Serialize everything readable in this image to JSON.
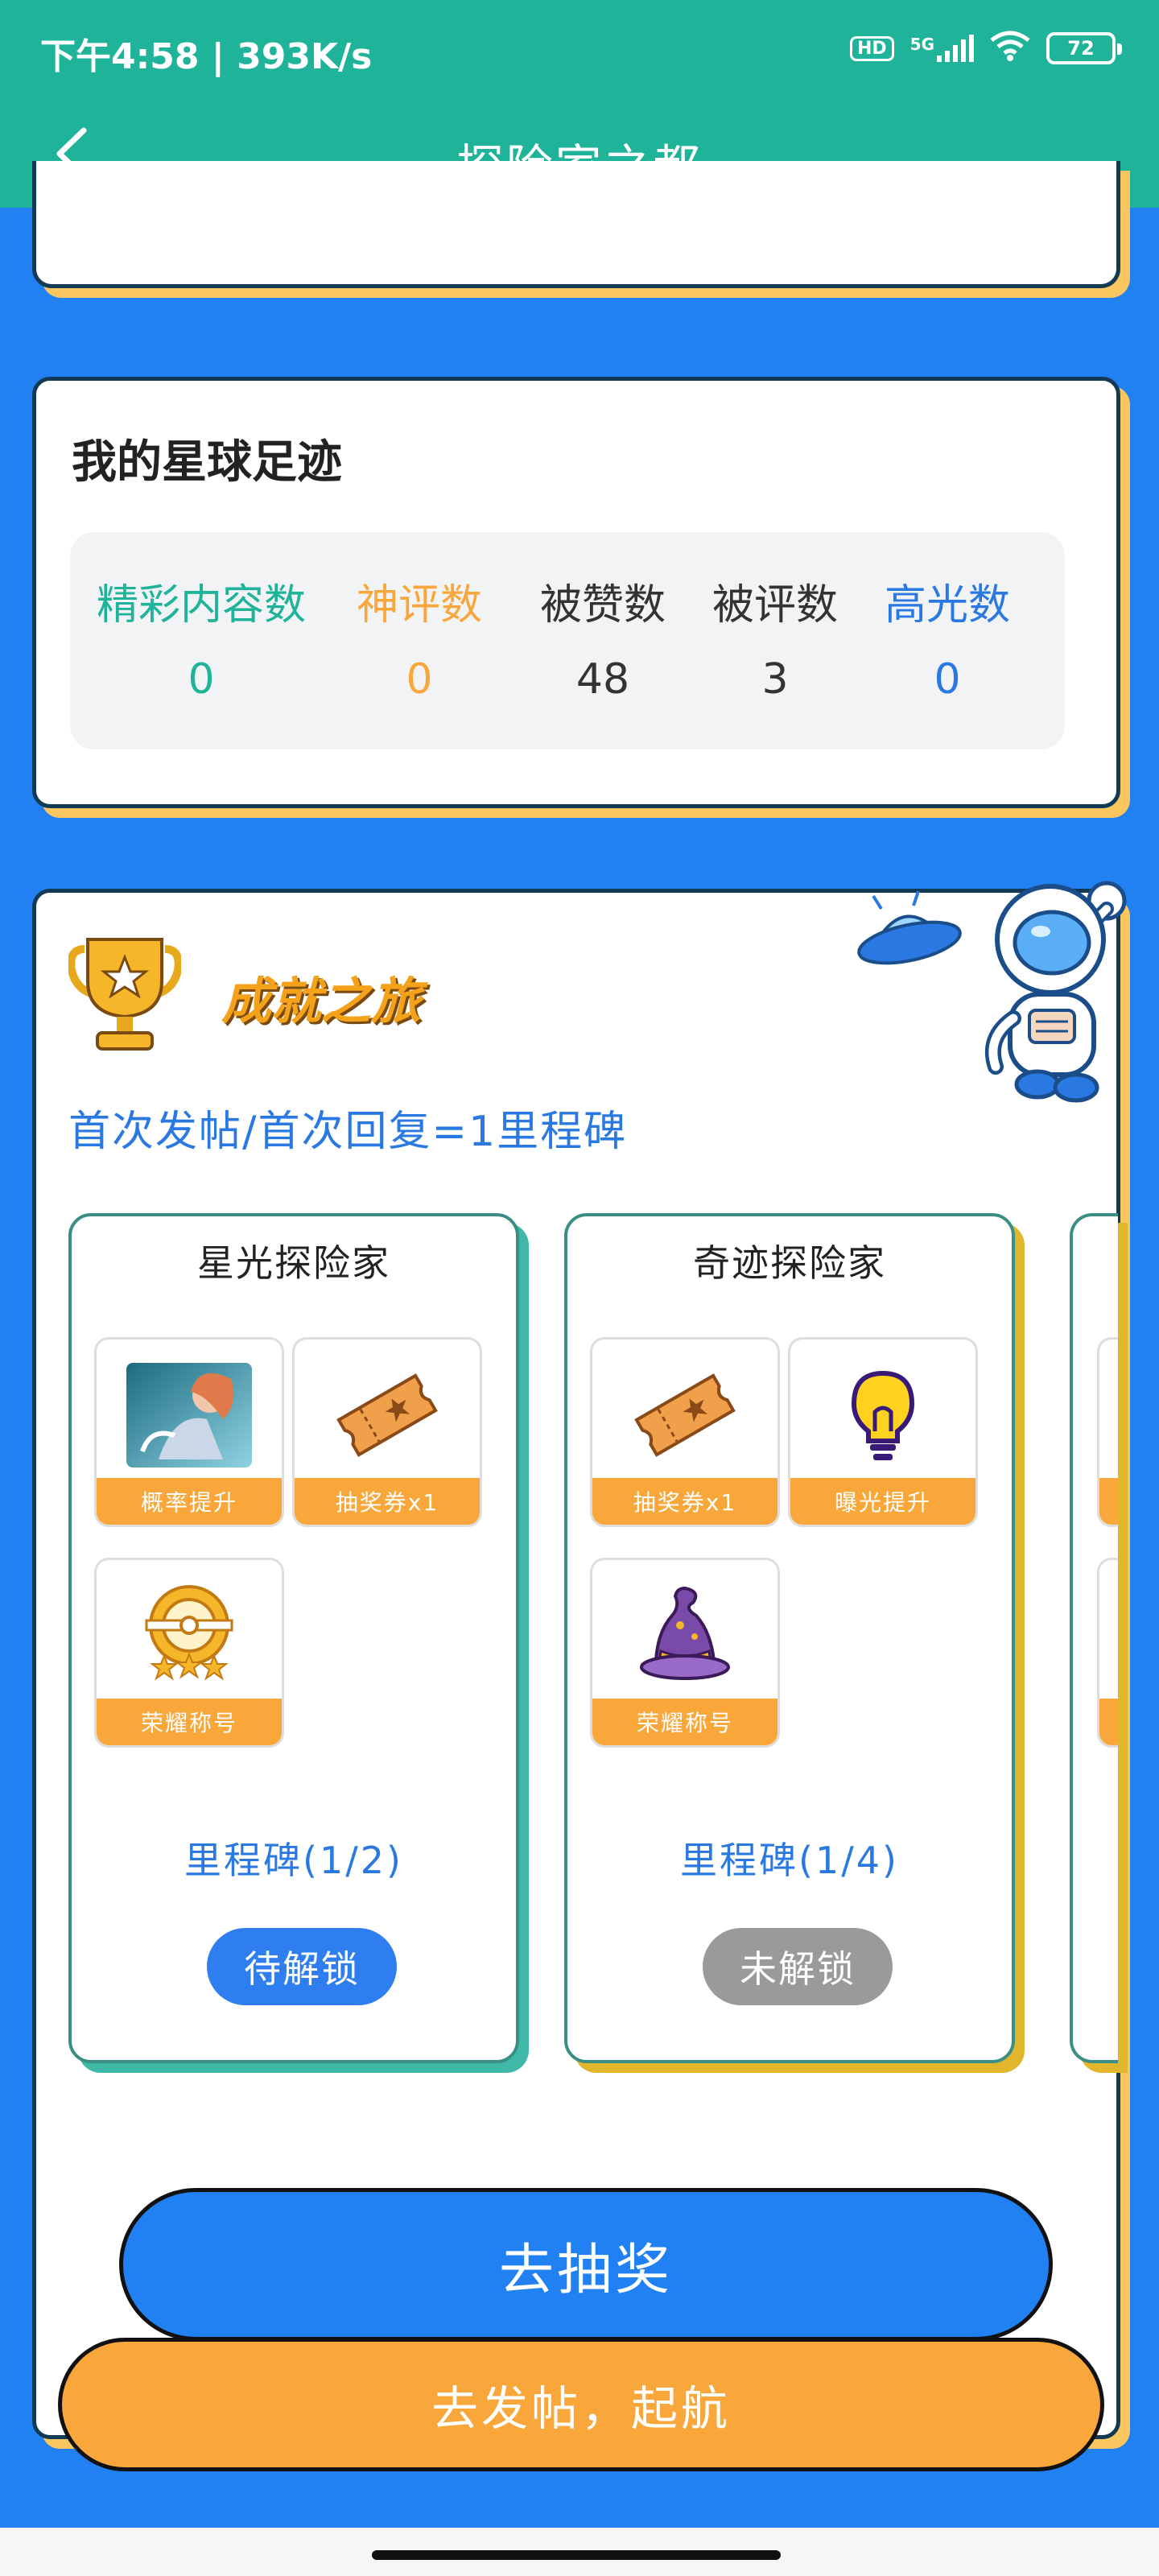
{
  "status_bar": {
    "time": "下午4:58 | 393K/s",
    "network": "5G",
    "hd": "HD",
    "battery": "72"
  },
  "nav": {
    "title": "探险家之都"
  },
  "footprint": {
    "title": "我的星球足迹",
    "stats": [
      {
        "label": "精彩内容数",
        "value": "0",
        "color": "#1fb49a"
      },
      {
        "label": "神评数",
        "value": "0",
        "color": "#f9a73b"
      },
      {
        "label": "被赞数",
        "value": "48",
        "color": "#333333"
      },
      {
        "label": "被评数",
        "value": "3",
        "color": "#333333"
      },
      {
        "label": "高光数",
        "value": "0",
        "color": "#2a78e2"
      }
    ]
  },
  "achievement": {
    "title": "成就之旅",
    "subtitle": "首次发帖/首次回复=1里程碑",
    "cards": [
      {
        "title": "星光探险家",
        "rewards": [
          {
            "label": "概率提升",
            "icon": "hero-portrait-icon"
          },
          {
            "label": "抽奖券x1",
            "icon": "lottery-ticket-icon"
          },
          {
            "label": "荣耀称号",
            "icon": "honor-medal-icon"
          }
        ],
        "milestone": "里程碑(1/2)",
        "button": "待解锁"
      },
      {
        "title": "奇迹探险家",
        "rewards": [
          {
            "label": "抽奖券x1",
            "icon": "lottery-ticket-icon"
          },
          {
            "label": "曝光提升",
            "icon": "lightbulb-icon"
          },
          {
            "label": "荣耀称号",
            "icon": "wizard-hat-icon"
          }
        ],
        "milestone": "里程碑(1/4)",
        "button": "未解锁"
      }
    ]
  },
  "actions": {
    "draw": "去抽奖",
    "post": "去发帖，起航"
  },
  "colors": {
    "header": "#1fb49a",
    "background": "#2180f2",
    "accent_orange": "#f9a73b",
    "accent_blue": "#2a78e2"
  }
}
